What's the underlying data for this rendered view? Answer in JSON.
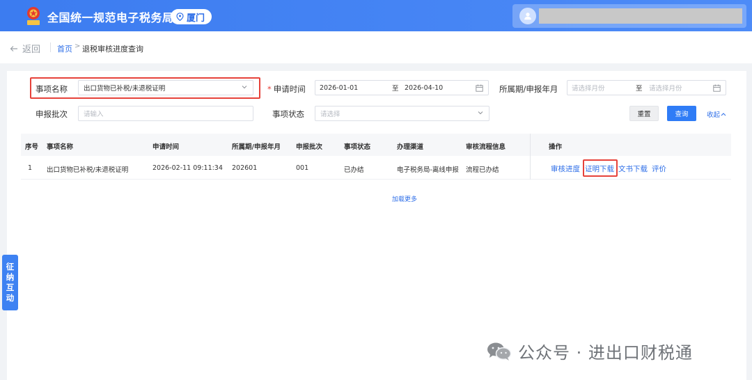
{
  "header": {
    "site_title": "全国统一规范电子税务局",
    "city": "厦门",
    "emblem_text": "TAX"
  },
  "breadcrumb": {
    "back_label": "返回",
    "home": "首页",
    "separator": ">",
    "current": "退税审核进度查询"
  },
  "filters": {
    "item_name_label": "事项名称",
    "item_name_value": "出口货物已补税/未退税证明",
    "apply_time_required": "*",
    "apply_time_label": "申请时间",
    "apply_time_start": "2026-01-01",
    "apply_time_to": "至",
    "apply_time_end": "2026-04-10",
    "period_label": "所属期/申报年月",
    "period_start_placeholder": "请选择月份",
    "period_to": "至",
    "period_end_placeholder": "请选择月份",
    "batch_label": "申报批次",
    "batch_placeholder": "请输入",
    "status_label": "事项状态",
    "status_placeholder": "请选择",
    "reset_label": "重置",
    "query_label": "查询",
    "collapse_label": "收起"
  },
  "table": {
    "headers": [
      "序号",
      "事项名称",
      "申请时间",
      "所属期/申报年月",
      "申报批次",
      "事项状态",
      "办理渠道",
      "审核流程信息",
      "操作"
    ],
    "rows": [
      {
        "index": "1",
        "name": "出口货物已补税/未退税证明",
        "apply_time": "2026-02-11 09:11:34",
        "period": "202601",
        "batch": "001",
        "status": "已办结",
        "channel": "电子税务局-离线申报",
        "process": "流程已办结",
        "ops": [
          "审核进度",
          "证明下载",
          "文书下载",
          "评价"
        ]
      }
    ],
    "load_more": "加载更多"
  },
  "side_tab": {
    "chars": [
      "征",
      "纳",
      "互",
      "动"
    ]
  },
  "watermark": {
    "text": "公众号 · 进出口财税通"
  },
  "colors": {
    "header_blue": "#3c7cf0",
    "link_blue": "#2f6fe8",
    "highlight_red": "#e6423a",
    "query_button": "#2f7cf6"
  }
}
